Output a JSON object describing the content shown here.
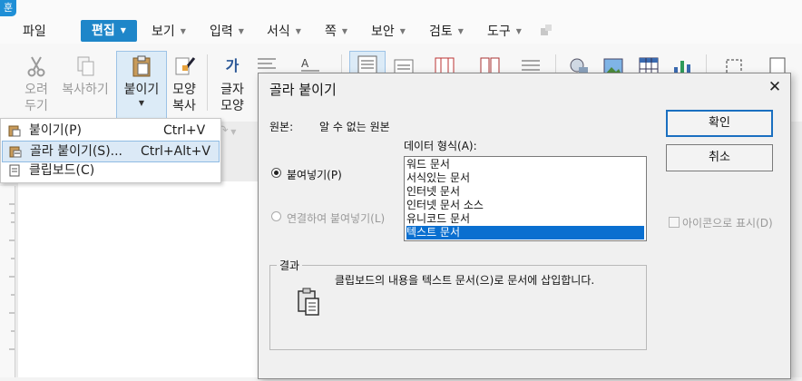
{
  "app": {
    "logo_char": "훈"
  },
  "menu": {
    "items": [
      {
        "label": "파일"
      },
      {
        "label": "편집"
      },
      {
        "label": "보기"
      },
      {
        "label": "입력"
      },
      {
        "label": "서식"
      },
      {
        "label": "쪽"
      },
      {
        "label": "보안"
      },
      {
        "label": "검토"
      },
      {
        "label": "도구"
      }
    ]
  },
  "ribbon": {
    "cut": {
      "line1": "오려",
      "line2": "두기"
    },
    "copy": {
      "label": "복사하기"
    },
    "paste": {
      "label": "붙이기"
    },
    "format_copy": {
      "line1": "모양",
      "line2": "복사"
    },
    "char_shape": {
      "line1": "글자",
      "line2": "모양"
    }
  },
  "paste_menu": {
    "items": [
      {
        "label": "붙이기(P)",
        "shortcut": "Ctrl+V"
      },
      {
        "label": "골라 붙이기(S)...",
        "shortcut": "Ctrl+Alt+V"
      },
      {
        "label": "클립보드(C)",
        "shortcut": ""
      }
    ]
  },
  "dialog": {
    "title": "골라 붙이기",
    "source_label": "원본:",
    "source_value": "알 수 없는 원본",
    "format_label": "데이터 형식(A):",
    "paste_radio": "붙여넣기(P)",
    "link_radio": "연결하여 붙여넣기(L)",
    "formats": [
      "워드 문서",
      "서식있는 문서",
      "인터넷 문서",
      "인터넷 문서 소스",
      "유니코드 문서",
      "텍스트 문서"
    ],
    "selected_format_index": 5,
    "ok": "확인",
    "cancel": "취소",
    "show_icon": "아이콘으로 표시(D)",
    "result_label": "결과",
    "result_text": "클립보드의 내용을 텍스트 문서(으)로 문서에 삽입합니다."
  }
}
